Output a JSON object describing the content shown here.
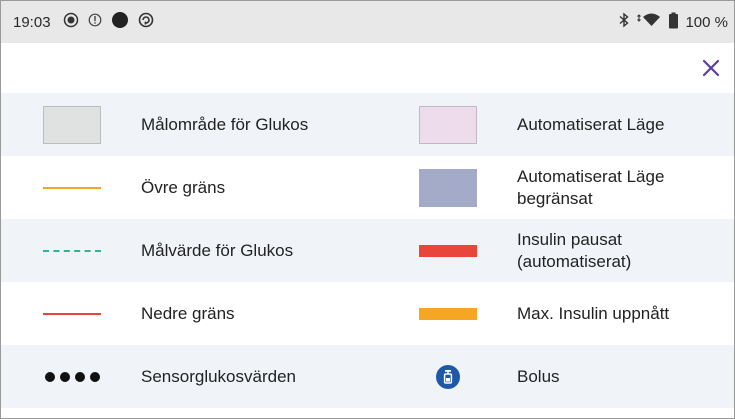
{
  "status_bar": {
    "time": "19:03",
    "left_icons": [
      "target-icon",
      "info-icon",
      "record-icon",
      "sync-icon"
    ],
    "right_icons": [
      "bluetooth-icon",
      "wifi-icon",
      "battery-icon"
    ],
    "battery": "100 %"
  },
  "header": {
    "close_icon": "close-icon",
    "close_color": "#5b3fa0"
  },
  "legend": {
    "rows": [
      {
        "left": {
          "symbol": "gray-swatch",
          "label": "Målområde för Glukos"
        },
        "right": {
          "symbol": "pink-swatch",
          "label": "Automatiserat Läge"
        }
      },
      {
        "left": {
          "symbol": "orange-line",
          "label": "Övre gräns"
        },
        "right": {
          "symbol": "blue-swatch",
          "label": "Automatiserat Läge\nbegränsat"
        }
      },
      {
        "left": {
          "symbol": "dashed-green-line",
          "label": "Målvärde för Glukos"
        },
        "right": {
          "symbol": "red-bar",
          "label": "Insulin pausat\n(automatiserat)"
        }
      },
      {
        "left": {
          "symbol": "red-line",
          "label": "Nedre gräns"
        },
        "right": {
          "symbol": "orange-bar",
          "label": "Max. Insulin uppnått"
        }
      },
      {
        "left": {
          "symbol": "dots",
          "label": "Sensorglukosvärden"
        },
        "right": {
          "symbol": "bolus-icon",
          "label": "Bolus"
        }
      }
    ]
  },
  "colors": {
    "orange": "#f5a623",
    "red": "#e8453c",
    "green": "#2fb39a",
    "bolus_blue": "#1f58a8",
    "row_alt_bg": "#f0f4f8"
  }
}
